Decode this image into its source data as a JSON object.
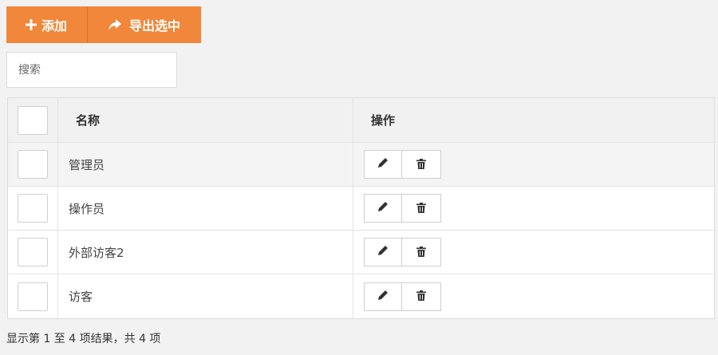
{
  "toolbar": {
    "add_label": "添加",
    "add_icon": "plus-icon",
    "export_label": "导出选中",
    "export_icon": "share-arrow-icon",
    "accent_color": "#f0873a"
  },
  "search": {
    "placeholder": "搜索",
    "value": ""
  },
  "table": {
    "columns": {
      "name": "名称",
      "actions": "操作"
    },
    "rows": [
      {
        "name": "管理员"
      },
      {
        "name": "操作员"
      },
      {
        "name": "外部访客2"
      },
      {
        "name": "访客"
      }
    ],
    "row_action_icons": [
      "pencil-icon",
      "trash-icon"
    ]
  },
  "footer": {
    "summary": "显示第 1 至 4 项结果，共 4 项"
  }
}
